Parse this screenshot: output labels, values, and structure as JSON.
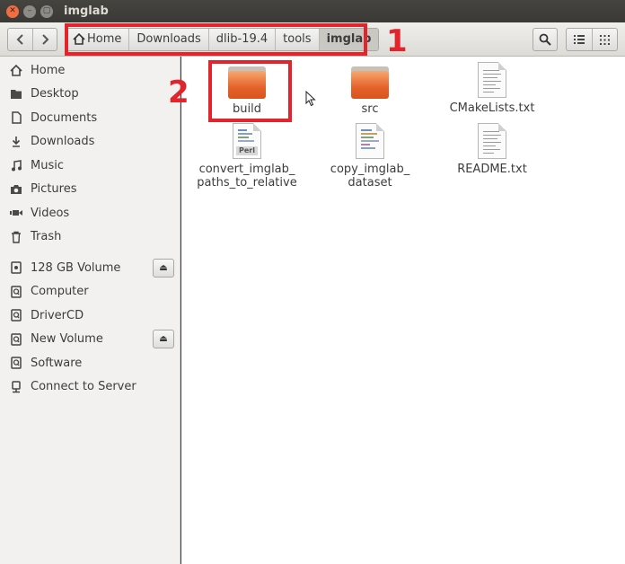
{
  "window": {
    "title": "imglab"
  },
  "toolbar": {
    "back_icon": "chevron-left-icon",
    "forward_icon": "chevron-right-icon",
    "breadcrumbs": [
      {
        "label": "Home",
        "icon": "home-icon"
      },
      {
        "label": "Downloads"
      },
      {
        "label": "dlib-19.4"
      },
      {
        "label": "tools"
      },
      {
        "label": "imglab",
        "active": true
      }
    ],
    "search_icon": "search-icon",
    "list_view_icon": "list-view-icon",
    "grid_view_icon": "grid-view-icon"
  },
  "annotations": {
    "label_1": "1",
    "label_2": "2",
    "color": "#e2242c"
  },
  "sidebar": {
    "places": [
      {
        "label": "Home",
        "icon": "home-icon"
      },
      {
        "label": "Desktop",
        "icon": "desktop-icon"
      },
      {
        "label": "Documents",
        "icon": "document-icon"
      },
      {
        "label": "Downloads",
        "icon": "download-icon"
      },
      {
        "label": "Music",
        "icon": "music-icon"
      },
      {
        "label": "Pictures",
        "icon": "camera-icon"
      },
      {
        "label": "Videos",
        "icon": "video-icon"
      },
      {
        "label": "Trash",
        "icon": "trash-icon"
      }
    ],
    "devices": [
      {
        "label": "128 GB Volume",
        "icon": "drive-icon",
        "eject": true
      },
      {
        "label": "Computer",
        "icon": "computer-icon"
      },
      {
        "label": "DriverCD",
        "icon": "disc-icon"
      },
      {
        "label": "New Volume",
        "icon": "drive-icon",
        "eject": true
      },
      {
        "label": "Software",
        "icon": "drive-icon"
      },
      {
        "label": "Connect to Server",
        "icon": "server-icon"
      }
    ]
  },
  "files": [
    {
      "name": "build",
      "type": "folder"
    },
    {
      "name": "src",
      "type": "folder"
    },
    {
      "name": "CMakeLists.txt",
      "type": "text"
    },
    {
      "name": "convert_imglab_\npaths_to_relative",
      "type": "perl",
      "badge": "Perl"
    },
    {
      "name": "copy_imglab_\ndataset",
      "type": "script"
    },
    {
      "name": "README.txt",
      "type": "text"
    }
  ],
  "colors": {
    "folder_orange": "#e5612a",
    "selection_red": "#e2242c",
    "sidebar_bg": "#f2f1f0"
  }
}
